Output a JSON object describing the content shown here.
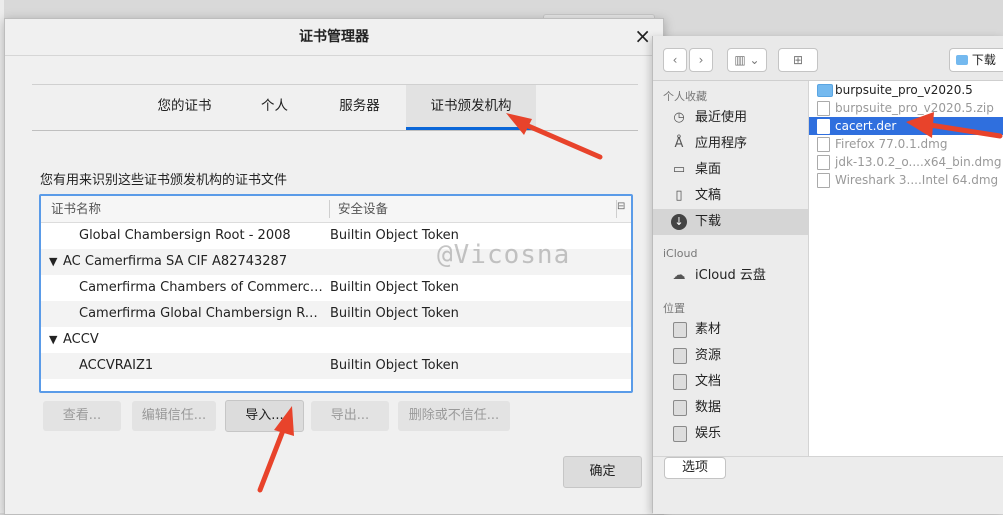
{
  "dialog": {
    "title": "证书管理器",
    "close_glyph": "×",
    "tabs": [
      "您的证书",
      "个人",
      "服务器",
      "证书颁发机构"
    ],
    "description": "您有用来识别这些证书颁发机构的证书文件",
    "columns": [
      "证书名称",
      "安全设备"
    ],
    "rows": [
      {
        "name": "Global Chambersign Root - 2008",
        "device": "Builtin Object Token"
      },
      {
        "group": "AC Camerfirma SA CIF A82743287"
      },
      {
        "name": "Camerfirma Chambers of Commerce Root",
        "device": "Builtin Object Token"
      },
      {
        "name": "Camerfirma Global Chambersign Root",
        "device": "Builtin Object Token"
      },
      {
        "group": "ACCV"
      },
      {
        "name": "ACCVRAIZ1",
        "device": "Builtin Object Token"
      }
    ],
    "buttons": [
      "查看...",
      "编辑信任...",
      "导入...",
      "导出...",
      "删除或不信任..."
    ],
    "ok": "确定"
  },
  "picker": {
    "toolbar": {
      "back": "‹",
      "forward": "›",
      "view": "▥ ⌄",
      "new_folder": "⊞",
      "location": "下载"
    },
    "sidebar": {
      "personal_header": "个人收藏",
      "personal": [
        {
          "label": "最近使用",
          "icon": "clock-icon"
        },
        {
          "label": "应用程序",
          "icon": "apps-icon"
        },
        {
          "label": "桌面",
          "icon": "desktop-icon"
        },
        {
          "label": "文稿",
          "icon": "document-icon"
        },
        {
          "label": "下载",
          "icon": "download-icon"
        }
      ],
      "icloud_header": "iCloud",
      "icloud": [
        {
          "label": "iCloud 云盘",
          "icon": "cloud-icon"
        }
      ],
      "locations_header": "位置",
      "locations": [
        "素材",
        "资源",
        "文档",
        "数据",
        "娱乐"
      ]
    },
    "files": [
      {
        "name": "burpsuite_pro_v2020.5",
        "type": "folder",
        "state": "normal"
      },
      {
        "name": "burpsuite_pro_v2020.5.zip",
        "type": "file",
        "state": "dim"
      },
      {
        "name": "cacert.der",
        "type": "file",
        "state": "selected"
      },
      {
        "name": "Firefox 77.0.1.dmg",
        "type": "file",
        "state": "dim"
      },
      {
        "name": "jdk-13.0.2_o....x64_bin.dmg",
        "type": "file",
        "state": "dim"
      },
      {
        "name": "Wireshark 3....Intel 64.dmg",
        "type": "file",
        "state": "dim"
      }
    ],
    "options_button": "选项"
  },
  "watermark": "@Vicosna",
  "colors": {
    "accent": "#0a66d8",
    "selection": "#2f6fde",
    "arrow": "#e8432b"
  }
}
